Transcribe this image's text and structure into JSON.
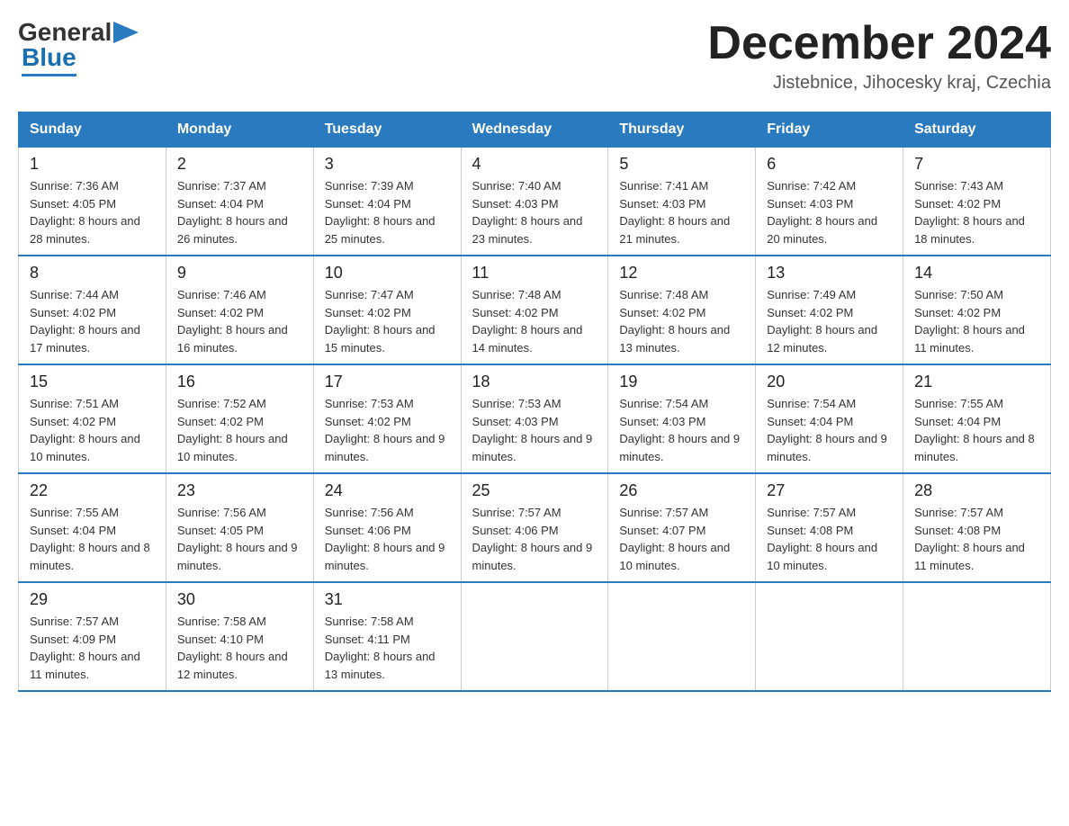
{
  "header": {
    "logo": {
      "general": "General",
      "blue": "Blue"
    },
    "title": "December 2024",
    "location": "Jistebnice, Jihocesky kraj, Czechia"
  },
  "columns": [
    "Sunday",
    "Monday",
    "Tuesday",
    "Wednesday",
    "Thursday",
    "Friday",
    "Saturday"
  ],
  "weeks": [
    [
      {
        "day": "1",
        "sunrise": "7:36 AM",
        "sunset": "4:05 PM",
        "daylight": "8 hours and 28 minutes."
      },
      {
        "day": "2",
        "sunrise": "7:37 AM",
        "sunset": "4:04 PM",
        "daylight": "8 hours and 26 minutes."
      },
      {
        "day": "3",
        "sunrise": "7:39 AM",
        "sunset": "4:04 PM",
        "daylight": "8 hours and 25 minutes."
      },
      {
        "day": "4",
        "sunrise": "7:40 AM",
        "sunset": "4:03 PM",
        "daylight": "8 hours and 23 minutes."
      },
      {
        "day": "5",
        "sunrise": "7:41 AM",
        "sunset": "4:03 PM",
        "daylight": "8 hours and 21 minutes."
      },
      {
        "day": "6",
        "sunrise": "7:42 AM",
        "sunset": "4:03 PM",
        "daylight": "8 hours and 20 minutes."
      },
      {
        "day": "7",
        "sunrise": "7:43 AM",
        "sunset": "4:02 PM",
        "daylight": "8 hours and 18 minutes."
      }
    ],
    [
      {
        "day": "8",
        "sunrise": "7:44 AM",
        "sunset": "4:02 PM",
        "daylight": "8 hours and 17 minutes."
      },
      {
        "day": "9",
        "sunrise": "7:46 AM",
        "sunset": "4:02 PM",
        "daylight": "8 hours and 16 minutes."
      },
      {
        "day": "10",
        "sunrise": "7:47 AM",
        "sunset": "4:02 PM",
        "daylight": "8 hours and 15 minutes."
      },
      {
        "day": "11",
        "sunrise": "7:48 AM",
        "sunset": "4:02 PM",
        "daylight": "8 hours and 14 minutes."
      },
      {
        "day": "12",
        "sunrise": "7:48 AM",
        "sunset": "4:02 PM",
        "daylight": "8 hours and 13 minutes."
      },
      {
        "day": "13",
        "sunrise": "7:49 AM",
        "sunset": "4:02 PM",
        "daylight": "8 hours and 12 minutes."
      },
      {
        "day": "14",
        "sunrise": "7:50 AM",
        "sunset": "4:02 PM",
        "daylight": "8 hours and 11 minutes."
      }
    ],
    [
      {
        "day": "15",
        "sunrise": "7:51 AM",
        "sunset": "4:02 PM",
        "daylight": "8 hours and 10 minutes."
      },
      {
        "day": "16",
        "sunrise": "7:52 AM",
        "sunset": "4:02 PM",
        "daylight": "8 hours and 10 minutes."
      },
      {
        "day": "17",
        "sunrise": "7:53 AM",
        "sunset": "4:02 PM",
        "daylight": "8 hours and 9 minutes."
      },
      {
        "day": "18",
        "sunrise": "7:53 AM",
        "sunset": "4:03 PM",
        "daylight": "8 hours and 9 minutes."
      },
      {
        "day": "19",
        "sunrise": "7:54 AM",
        "sunset": "4:03 PM",
        "daylight": "8 hours and 9 minutes."
      },
      {
        "day": "20",
        "sunrise": "7:54 AM",
        "sunset": "4:04 PM",
        "daylight": "8 hours and 9 minutes."
      },
      {
        "day": "21",
        "sunrise": "7:55 AM",
        "sunset": "4:04 PM",
        "daylight": "8 hours and 8 minutes."
      }
    ],
    [
      {
        "day": "22",
        "sunrise": "7:55 AM",
        "sunset": "4:04 PM",
        "daylight": "8 hours and 8 minutes."
      },
      {
        "day": "23",
        "sunrise": "7:56 AM",
        "sunset": "4:05 PM",
        "daylight": "8 hours and 9 minutes."
      },
      {
        "day": "24",
        "sunrise": "7:56 AM",
        "sunset": "4:06 PM",
        "daylight": "8 hours and 9 minutes."
      },
      {
        "day": "25",
        "sunrise": "7:57 AM",
        "sunset": "4:06 PM",
        "daylight": "8 hours and 9 minutes."
      },
      {
        "day": "26",
        "sunrise": "7:57 AM",
        "sunset": "4:07 PM",
        "daylight": "8 hours and 10 minutes."
      },
      {
        "day": "27",
        "sunrise": "7:57 AM",
        "sunset": "4:08 PM",
        "daylight": "8 hours and 10 minutes."
      },
      {
        "day": "28",
        "sunrise": "7:57 AM",
        "sunset": "4:08 PM",
        "daylight": "8 hours and 11 minutes."
      }
    ],
    [
      {
        "day": "29",
        "sunrise": "7:57 AM",
        "sunset": "4:09 PM",
        "daylight": "8 hours and 11 minutes."
      },
      {
        "day": "30",
        "sunrise": "7:58 AM",
        "sunset": "4:10 PM",
        "daylight": "8 hours and 12 minutes."
      },
      {
        "day": "31",
        "sunrise": "7:58 AM",
        "sunset": "4:11 PM",
        "daylight": "8 hours and 13 minutes."
      },
      null,
      null,
      null,
      null
    ]
  ]
}
